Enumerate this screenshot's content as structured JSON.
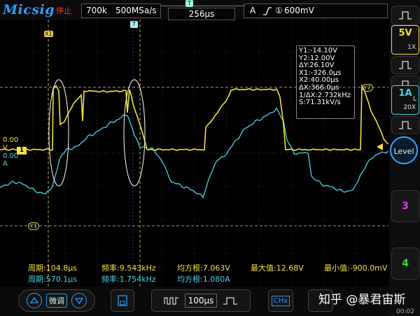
{
  "header": {
    "logo": "Micsig",
    "run_state": "停止",
    "memory_depth": "700k",
    "sample_rate": "500MSa/s",
    "timebase_position": "256μs",
    "trigger_source": "A",
    "trigger_slope_icon": "rising-edge-icon",
    "trigger_channel_marker": "①",
    "trigger_level": "600mV"
  },
  "markers": {
    "trigger_top": "T",
    "trigger_mid": "T",
    "x1": "X1",
    "y1": "Y1",
    "y2": "Y2",
    "ch1": "1",
    "ch1_offset": "0.00",
    "chA_offset": "0.00",
    "chA_label": "A",
    "ch1_side": "V"
  },
  "cursor_readout": {
    "y1": "Y1:-14.10V",
    "y2": "Y2:12.00V",
    "dy": "ΔY:26.10V",
    "x1": "X1:-326.0μs",
    "x2": "X2:40.00μs",
    "dx": "ΔX:366.0μs",
    "inv_dx": "1/ΔX:2.732kHz",
    "slew": "S:71.31kV/s"
  },
  "measurements": {
    "row1": {
      "period": "周期:104.8μs",
      "freq": "频率:9.543kHz",
      "rms": "均方根:7.063V",
      "max": "最大值:12.68V",
      "min": "最小值:-900.0mV"
    },
    "row2": {
      "period": "周期:570.1μs",
      "freq": "频率:1.754kHz",
      "rms": "均方根:1.080A"
    }
  },
  "sidebar": {
    "ch1_scale": "5V",
    "ch1_probe": "1X",
    "chA_scale": "1A",
    "chA_probe": "20X",
    "chA_coupling": "L",
    "level_button": "Level",
    "ch3_button": "3",
    "ch4_button": "4"
  },
  "bottombar": {
    "fine_adjust": "微调",
    "timebase": "100μs",
    "hex_button": "CHx"
  },
  "watermark": "知乎 @暴君宙斯",
  "clock": "00:02",
  "colors": {
    "ch1": "#f3e23a",
    "chA": "#45d4e6",
    "accent": "#2f9bff",
    "ch3": "#e040e0",
    "ch4": "#38e038"
  }
}
